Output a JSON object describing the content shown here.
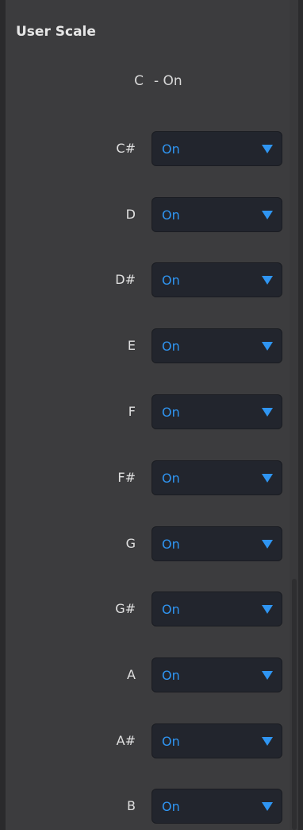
{
  "panel": {
    "title": "User Scale",
    "root_note": {
      "note": "C",
      "state": "- On"
    },
    "notes": [
      {
        "note": "C#",
        "value": "On"
      },
      {
        "note": "D",
        "value": "On"
      },
      {
        "note": "D#",
        "value": "On"
      },
      {
        "note": "E",
        "value": "On"
      },
      {
        "note": "F",
        "value": "On"
      },
      {
        "note": "F#",
        "value": "On"
      },
      {
        "note": "G",
        "value": "On"
      },
      {
        "note": "G#",
        "value": "On"
      },
      {
        "note": "A",
        "value": "On"
      },
      {
        "note": "A#",
        "value": "On"
      },
      {
        "note": "B",
        "value": "On"
      }
    ]
  },
  "colors": {
    "background": "#3c3c3e",
    "dropdown_bg": "#22252d",
    "accent": "#2f95f2",
    "label": "#e0e0e0"
  },
  "icons": {
    "dropdown_arrow": "triangle-down-icon"
  }
}
